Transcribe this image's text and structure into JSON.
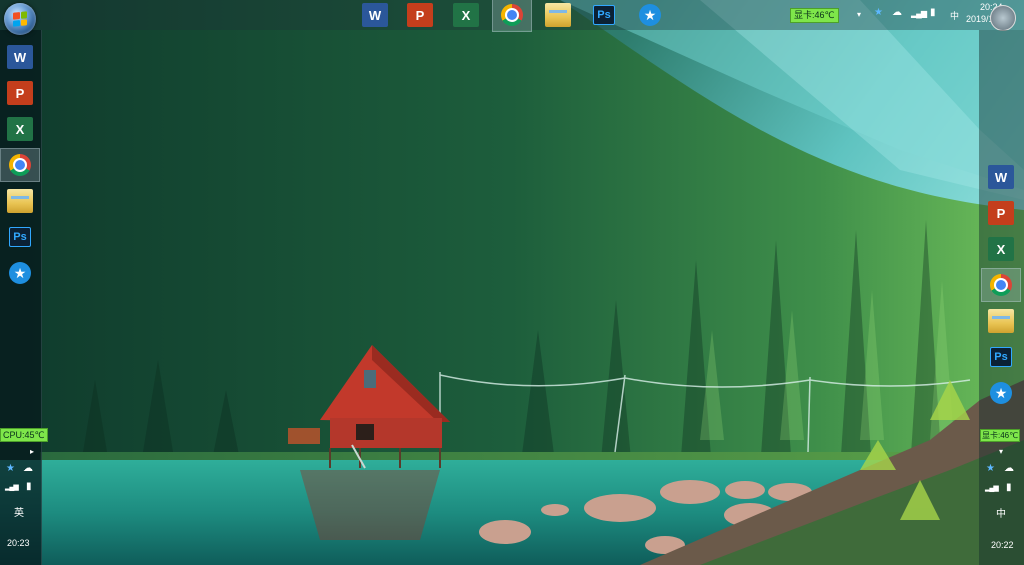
{
  "desktop": {
    "wallpaper": "forest-lake-cabin"
  },
  "top_taskbar": {
    "apps": [
      {
        "id": "word",
        "label": "W",
        "icon": "word-icon"
      },
      {
        "id": "ppt",
        "label": "P",
        "icon": "powerpoint-icon"
      },
      {
        "id": "excel",
        "label": "X",
        "icon": "excel-icon"
      },
      {
        "id": "chrome",
        "label": "",
        "icon": "chrome-icon",
        "active": true
      },
      {
        "id": "explorer",
        "label": "",
        "icon": "folder-icon"
      },
      {
        "id": "ps",
        "label": "Ps",
        "icon": "photoshop-icon"
      },
      {
        "id": "star",
        "label": "★",
        "icon": "star-app-icon"
      }
    ],
    "gpu_temp": "显卡:46℃",
    "ime": "中",
    "time": "20:24",
    "date": "2019/1/12"
  },
  "left_taskbar": {
    "apps": [
      {
        "id": "word",
        "label": "W"
      },
      {
        "id": "ppt",
        "label": "P"
      },
      {
        "id": "excel",
        "label": "X"
      },
      {
        "id": "chrome",
        "label": "",
        "active": true
      },
      {
        "id": "explorer",
        "label": ""
      },
      {
        "id": "ps",
        "label": "Ps"
      },
      {
        "id": "star",
        "label": "★"
      }
    ],
    "cpu_temp": "CPU:45℃",
    "ime": "英",
    "time": "20:23"
  },
  "right_taskbar": {
    "apps": [
      {
        "id": "word",
        "label": "W"
      },
      {
        "id": "ppt",
        "label": "P"
      },
      {
        "id": "excel",
        "label": "X"
      },
      {
        "id": "chrome",
        "label": "",
        "active": true
      },
      {
        "id": "explorer",
        "label": ""
      },
      {
        "id": "ps",
        "label": "Ps"
      },
      {
        "id": "star",
        "label": "★"
      }
    ],
    "gpu_temp": "显卡:46℃",
    "ime": "中",
    "time": "20:22"
  },
  "colors": {
    "word": "#2b579a",
    "ppt": "#c43e1c",
    "excel": "#217346",
    "ps": "#31a8ff",
    "temp_badge": "#7ee64a"
  }
}
